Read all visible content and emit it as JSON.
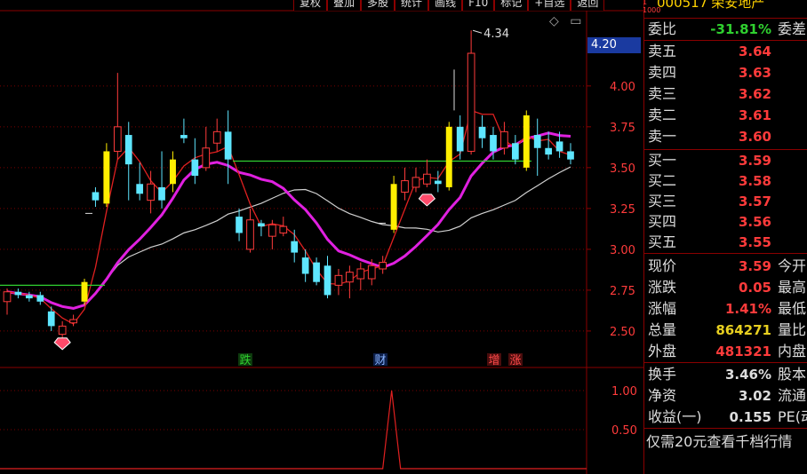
{
  "toolbar": {
    "buttons": [
      "复权",
      "叠加",
      "多股",
      "统计",
      "画线",
      "F10",
      "标记",
      "+自选",
      "返回"
    ]
  },
  "stock": {
    "code": "000517",
    "name": "荣安地产",
    "index_tag_1": "1",
    "index_tag_2": "1000"
  },
  "chart_icons": {
    "diamond": "◇",
    "window": "▭"
  },
  "price_box": "4.20",
  "high_marker": "4.34",
  "signals": [
    {
      "text": "跌",
      "color": "#2fd02f",
      "bg": "#0d3a0d"
    },
    {
      "text": "财",
      "color": "#8ab4ff",
      "bg": "#0d1f4a"
    },
    {
      "text": "增",
      "color": "#ff4a4a",
      "bg": "#4a0d0d"
    },
    {
      "text": "涨",
      "color": "#ff4a4a",
      "bg": "#4a0d0d"
    }
  ],
  "chart_data": {
    "type": "candlestick",
    "ylim": [
      2.38,
      4.45
    ],
    "price_ticks": [
      "4.00",
      "3.75",
      "3.50",
      "3.25",
      "3.00",
      "2.75",
      "2.50"
    ],
    "candles": [
      {
        "o": 2.68,
        "c": 2.74,
        "h": 2.76,
        "l": 2.6
      },
      {
        "o": 2.74,
        "c": 2.72,
        "h": 2.76,
        "l": 2.7
      },
      {
        "o": 2.72,
        "c": 2.7,
        "h": 2.74,
        "l": 2.68
      },
      {
        "o": 2.72,
        "c": 2.68,
        "h": 2.74,
        "l": 2.66
      },
      {
        "o": 2.62,
        "c": 2.53,
        "h": 2.65,
        "l": 2.5
      },
      {
        "o": 2.48,
        "c": 2.53,
        "h": 2.56,
        "l": 2.44
      },
      {
        "o": 2.55,
        "c": 2.57,
        "h": 2.6,
        "l": 2.53
      },
      {
        "o": 2.68,
        "c": 2.8,
        "h": 2.82,
        "l": 2.66
      },
      {
        "o": 3.35,
        "c": 3.3,
        "h": 3.38,
        "l": 3.26
      },
      {
        "o": 3.28,
        "c": 3.6,
        "h": 3.65,
        "l": 3.26
      },
      {
        "o": 3.6,
        "c": 3.75,
        "h": 4.08,
        "l": 3.55
      },
      {
        "o": 3.7,
        "c": 3.52,
        "h": 3.78,
        "l": 3.3
      },
      {
        "o": 3.4,
        "c": 3.34,
        "h": 3.53,
        "l": 3.3
      },
      {
        "o": 3.3,
        "c": 3.4,
        "h": 3.48,
        "l": 3.22
      },
      {
        "o": 3.38,
        "c": 3.3,
        "h": 3.6,
        "l": 3.25
      },
      {
        "o": 3.4,
        "c": 3.55,
        "h": 3.6,
        "l": 3.35
      },
      {
        "o": 3.7,
        "c": 3.68,
        "h": 3.8,
        "l": 3.65
      },
      {
        "o": 3.55,
        "c": 3.45,
        "h": 3.68,
        "l": 3.4
      },
      {
        "o": 3.5,
        "c": 3.62,
        "h": 3.75,
        "l": 3.48
      },
      {
        "o": 3.65,
        "c": 3.72,
        "h": 3.8,
        "l": 3.6
      },
      {
        "o": 3.72,
        "c": 3.55,
        "h": 3.85,
        "l": 3.4
      },
      {
        "o": 3.2,
        "c": 3.1,
        "h": 3.25,
        "l": 3.05
      },
      {
        "o": 3.0,
        "c": 3.18,
        "h": 3.25,
        "l": 2.98
      },
      {
        "o": 3.16,
        "c": 3.14,
        "h": 3.18,
        "l": 3.08
      },
      {
        "o": 3.08,
        "c": 3.15,
        "h": 3.18,
        "l": 3.0
      },
      {
        "o": 3.1,
        "c": 3.14,
        "h": 3.2,
        "l": 3.08
      },
      {
        "o": 3.05,
        "c": 2.98,
        "h": 3.12,
        "l": 2.92
      },
      {
        "o": 2.95,
        "c": 2.85,
        "h": 3.0,
        "l": 2.8
      },
      {
        "o": 2.92,
        "c": 2.8,
        "h": 2.95,
        "l": 2.78
      },
      {
        "o": 2.9,
        "c": 2.72,
        "h": 2.96,
        "l": 2.7
      },
      {
        "o": 2.78,
        "c": 2.84,
        "h": 2.88,
        "l": 2.72
      },
      {
        "o": 2.8,
        "c": 2.86,
        "h": 2.9,
        "l": 2.7
      },
      {
        "o": 2.82,
        "c": 2.88,
        "h": 2.92,
        "l": 2.75
      },
      {
        "o": 2.82,
        "c": 2.9,
        "h": 2.94,
        "l": 2.78
      },
      {
        "o": 2.88,
        "c": 2.92,
        "h": 2.96,
        "l": 2.85
      },
      {
        "o": 3.12,
        "c": 3.4,
        "h": 3.45,
        "l": 3.1
      },
      {
        "o": 3.35,
        "c": 3.42,
        "h": 3.5,
        "l": 3.3
      },
      {
        "o": 3.38,
        "c": 3.44,
        "h": 3.5,
        "l": 3.35
      },
      {
        "o": 3.4,
        "c": 3.46,
        "h": 3.55,
        "l": 3.38
      },
      {
        "o": 3.42,
        "c": 3.4,
        "h": 3.48,
        "l": 3.35
      },
      {
        "o": 3.38,
        "c": 3.75,
        "h": 3.78,
        "l": 3.36
      },
      {
        "o": 3.75,
        "c": 3.6,
        "h": 3.82,
        "l": 3.55
      },
      {
        "o": 3.6,
        "c": 4.2,
        "h": 4.34,
        "l": 3.58
      },
      {
        "o": 3.75,
        "c": 3.68,
        "h": 3.82,
        "l": 3.62
      },
      {
        "o": 3.7,
        "c": 3.6,
        "h": 3.75,
        "l": 3.55
      },
      {
        "o": 3.62,
        "c": 3.72,
        "h": 3.78,
        "l": 3.58
      },
      {
        "o": 3.65,
        "c": 3.55,
        "h": 3.7,
        "l": 3.52
      },
      {
        "o": 3.5,
        "c": 3.82,
        "h": 3.85,
        "l": 3.48
      },
      {
        "o": 3.7,
        "c": 3.62,
        "h": 3.8,
        "l": 3.45
      },
      {
        "o": 3.62,
        "c": 3.58,
        "h": 3.72,
        "l": 3.55
      },
      {
        "o": 3.66,
        "c": 3.6,
        "h": 3.72,
        "l": 3.56
      },
      {
        "o": 3.6,
        "c": 3.55,
        "h": 3.65,
        "l": 3.52
      }
    ],
    "yellow_candles": [
      7,
      9,
      15,
      35,
      40,
      47
    ],
    "indicator_ticks": [
      "1.00",
      "0.50"
    ],
    "indicator_spike": 1.0
  },
  "quote": {
    "webi_label": "委比",
    "webi_value": "-31.81%",
    "webi_right": "委差",
    "asks": [
      {
        "label": "卖五",
        "price": "3.64"
      },
      {
        "label": "卖四",
        "price": "3.63"
      },
      {
        "label": "卖三",
        "price": "3.62"
      },
      {
        "label": "卖二",
        "price": "3.61"
      },
      {
        "label": "卖一",
        "price": "3.60"
      }
    ],
    "bids": [
      {
        "label": "买一",
        "price": "3.59"
      },
      {
        "label": "买二",
        "price": "3.58"
      },
      {
        "label": "买三",
        "price": "3.57"
      },
      {
        "label": "买四",
        "price": "3.56"
      },
      {
        "label": "买五",
        "price": "3.55"
      }
    ],
    "stats": [
      {
        "label": "现价",
        "value": "3.59",
        "right": "今开",
        "color": "#ff3b3b"
      },
      {
        "label": "涨跌",
        "value": "0.05",
        "right": "最高",
        "color": "#ff3b3b"
      },
      {
        "label": "涨幅",
        "value": "1.41%",
        "right": "最低",
        "color": "#ff3b3b"
      },
      {
        "label": "总量",
        "value": "864271",
        "right": "量比",
        "color": "#e8d020"
      },
      {
        "label": "外盘",
        "value": "481321",
        "right": "内盘",
        "color": "#ff3b3b"
      }
    ],
    "fin": [
      {
        "label": "换手",
        "value": "3.46%",
        "right": "股本"
      },
      {
        "label": "净资",
        "value": "3.02",
        "right": "流通"
      },
      {
        "label": "收益(一)",
        "value": "0.155",
        "right": "PE(动"
      }
    ],
    "note": "仅需20元查看千档行情"
  },
  "colors": {
    "up": "#ff3b3b",
    "down": "#5ee6ff",
    "yellow": "#ffee00",
    "ma_red": "#e02020",
    "ma_magenta": "#e020e0",
    "ma_white": "#d0d0d0",
    "ma_green": "#30d030",
    "grid": "#7a0000",
    "negative": "#2fd02f"
  }
}
